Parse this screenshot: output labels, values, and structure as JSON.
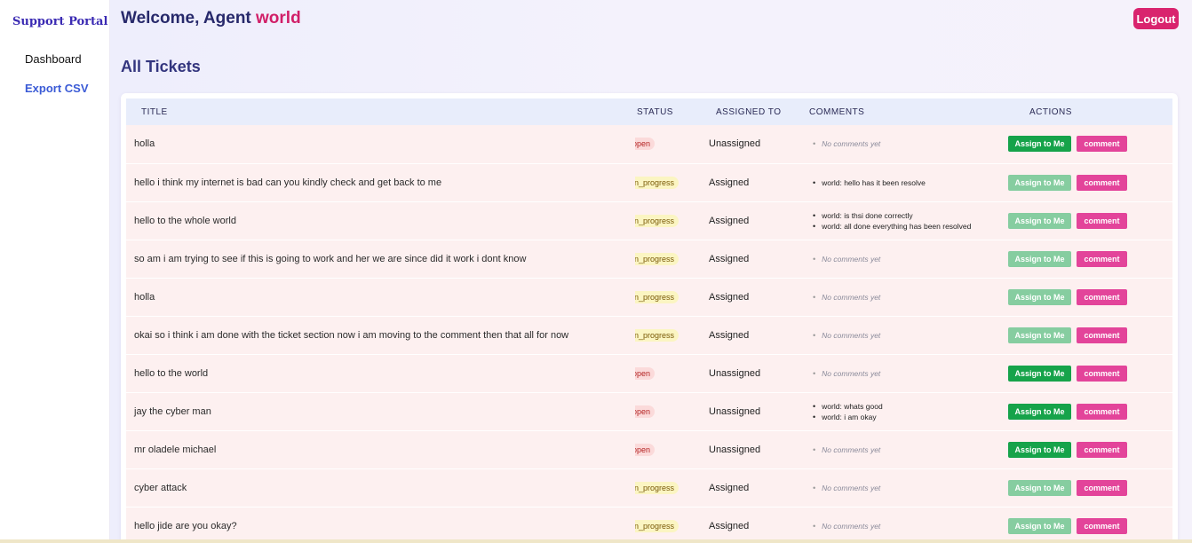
{
  "sidebar": {
    "brand": "Support Portal",
    "items": [
      {
        "label": "Dashboard"
      },
      {
        "label": "Export CSV"
      }
    ]
  },
  "header": {
    "welcome_prefix": "Welcome, Agent",
    "agent_name": "world",
    "logout_label": "Logout"
  },
  "main": {
    "section_title": "All Tickets",
    "columns": [
      "TITLE",
      "STATUS",
      "ASSIGNED TO",
      "COMMENTS",
      "ACTIONS"
    ],
    "assign_label": "Assign to Me",
    "comment_label": "comment",
    "empty_comments": "No comments yet"
  },
  "tickets": [
    {
      "title": "holla",
      "status": "open",
      "assigned": "Unassigned",
      "comments": [],
      "assign_enabled": true
    },
    {
      "title": "hello i think my internet is bad can you kindly check and get back to me",
      "status": "in_progress",
      "assigned": "Assigned",
      "comments": [
        "world: hello has it been resolve"
      ],
      "assign_enabled": false
    },
    {
      "title": "hello to the whole world",
      "status": "in_progress",
      "assigned": "Assigned",
      "comments": [
        "world: is thsi done correctly",
        "world: all done everything has been resolved"
      ],
      "assign_enabled": false
    },
    {
      "title": "so am i am trying to see if this is going to work and her we are since did it work i dont know",
      "status": "in_progress",
      "assigned": "Assigned",
      "comments": [],
      "assign_enabled": false
    },
    {
      "title": "holla",
      "status": "in_progress",
      "assigned": "Assigned",
      "comments": [],
      "assign_enabled": false
    },
    {
      "title": "okai so i think i am done with the ticket section now i am moving to the comment then that all for now",
      "status": "in_progress",
      "assigned": "Assigned",
      "comments": [],
      "assign_enabled": false
    },
    {
      "title": "hello to the world",
      "status": "open",
      "assigned": "Unassigned",
      "comments": [],
      "assign_enabled": true
    },
    {
      "title": "jay the cyber man",
      "status": "open",
      "assigned": "Unassigned",
      "comments": [
        "world: whats good",
        "world: i am okay"
      ],
      "assign_enabled": true
    },
    {
      "title": "mr oladele michael",
      "status": "open",
      "assigned": "Unassigned",
      "comments": [],
      "assign_enabled": true
    },
    {
      "title": "cyber attack",
      "status": "in_progress",
      "assigned": "Assigned",
      "comments": [],
      "assign_enabled": false
    },
    {
      "title": "hello jide are you okay?",
      "status": "in_progress",
      "assigned": "Assigned",
      "comments": [],
      "assign_enabled": false
    }
  ],
  "colors": {
    "brand": "#3b2bb3",
    "accent_pink": "#d9246e",
    "assign_green": "#16a34a",
    "assign_disabled": "#86cda0",
    "comment_pink": "#e3449a",
    "row_bg": "#fdf0f0",
    "header_bg": "#e8edfb"
  }
}
